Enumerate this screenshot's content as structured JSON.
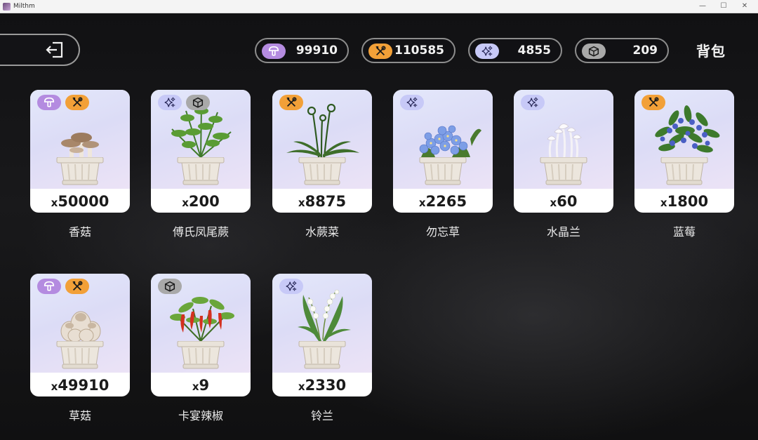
{
  "window": {
    "title": "Milthm",
    "controls": [
      "—",
      "☐",
      "✕"
    ]
  },
  "header": {
    "title": "背包",
    "resources": [
      {
        "icon": "mushroom-icon",
        "color": "#b48be0",
        "value": "99910"
      },
      {
        "icon": "tool-icon",
        "color": "#f2a038",
        "value": "110585"
      },
      {
        "icon": "sparkle-icon",
        "color": "#c7c9f7",
        "value": "4855"
      },
      {
        "icon": "box-icon",
        "color": "#a9a9a9",
        "value": "209"
      }
    ]
  },
  "items": [
    {
      "name": "香菇",
      "qty_prefix": "x",
      "qty": "50000",
      "tags": [
        "mushroom",
        "tool"
      ]
    },
    {
      "name": "傅氏凤尾蕨",
      "qty_prefix": "x",
      "qty": "200",
      "tags": [
        "sparkle",
        "box"
      ]
    },
    {
      "name": "水蕨菜",
      "qty_prefix": "x",
      "qty": "8875",
      "tags": [
        "tool"
      ]
    },
    {
      "name": "勿忘草",
      "qty_prefix": "x",
      "qty": "2265",
      "tags": [
        "sparkle"
      ]
    },
    {
      "name": "水晶兰",
      "qty_prefix": "x",
      "qty": "60",
      "tags": [
        "sparkle"
      ]
    },
    {
      "name": "蓝莓",
      "qty_prefix": "x",
      "qty": "1800",
      "tags": [
        "tool"
      ]
    },
    {
      "name": "草菇",
      "qty_prefix": "x",
      "qty": "49910",
      "tags": [
        "mushroom",
        "tool"
      ]
    },
    {
      "name": "卡宴辣椒",
      "qty_prefix": "x",
      "qty": "9",
      "tags": [
        "box"
      ]
    },
    {
      "name": "铃兰",
      "qty_prefix": "x",
      "qty": "2330",
      "tags": [
        "sparkle"
      ]
    }
  ]
}
